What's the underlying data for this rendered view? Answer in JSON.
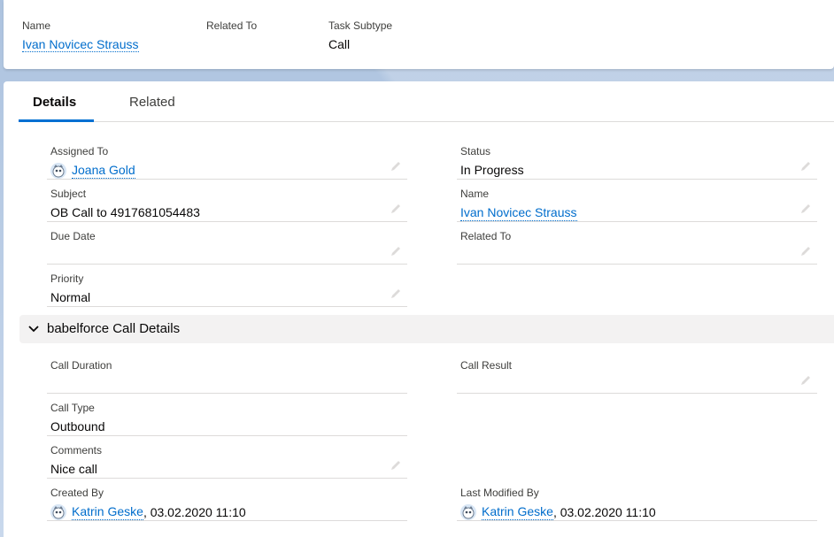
{
  "header": {
    "fields": [
      {
        "label": "Name",
        "value": "Ivan Novicec Strauss"
      },
      {
        "label": "Related To",
        "value": ""
      },
      {
        "label": "Task Subtype",
        "value": "Call"
      }
    ]
  },
  "tabs": [
    {
      "label": "Details"
    },
    {
      "label": "Related"
    }
  ],
  "details": {
    "assigned_to": {
      "label": "Assigned To",
      "value": "Joana Gold"
    },
    "status": {
      "label": "Status",
      "value": "In Progress"
    },
    "subject": {
      "label": "Subject",
      "value": "OB Call to 4917681054483"
    },
    "name": {
      "label": "Name",
      "value": "Ivan Novicec Strauss"
    },
    "due_date": {
      "label": "Due Date",
      "value": ""
    },
    "related_to": {
      "label": "Related To",
      "value": ""
    },
    "priority": {
      "label": "Priority",
      "value": "Normal"
    }
  },
  "section": {
    "title": "babelforce Call Details",
    "call_duration": {
      "label": "Call Duration",
      "value": ""
    },
    "call_result": {
      "label": "Call Result",
      "value": ""
    },
    "call_type": {
      "label": "Call Type",
      "value": "Outbound"
    },
    "comments": {
      "label": "Comments",
      "value": "Nice call"
    },
    "created_by": {
      "label": "Created By",
      "user": "Katrin Geske",
      "date": ", 03.02.2020 11:10"
    },
    "last_modified_by": {
      "label": "Last Modified By",
      "user": "Katrin Geske",
      "date": ", 03.02.2020 11:10"
    }
  },
  "colors": {
    "link": "#006dcc",
    "tab_accent": "#0070d2",
    "section_bg": "#f3f2f2"
  }
}
